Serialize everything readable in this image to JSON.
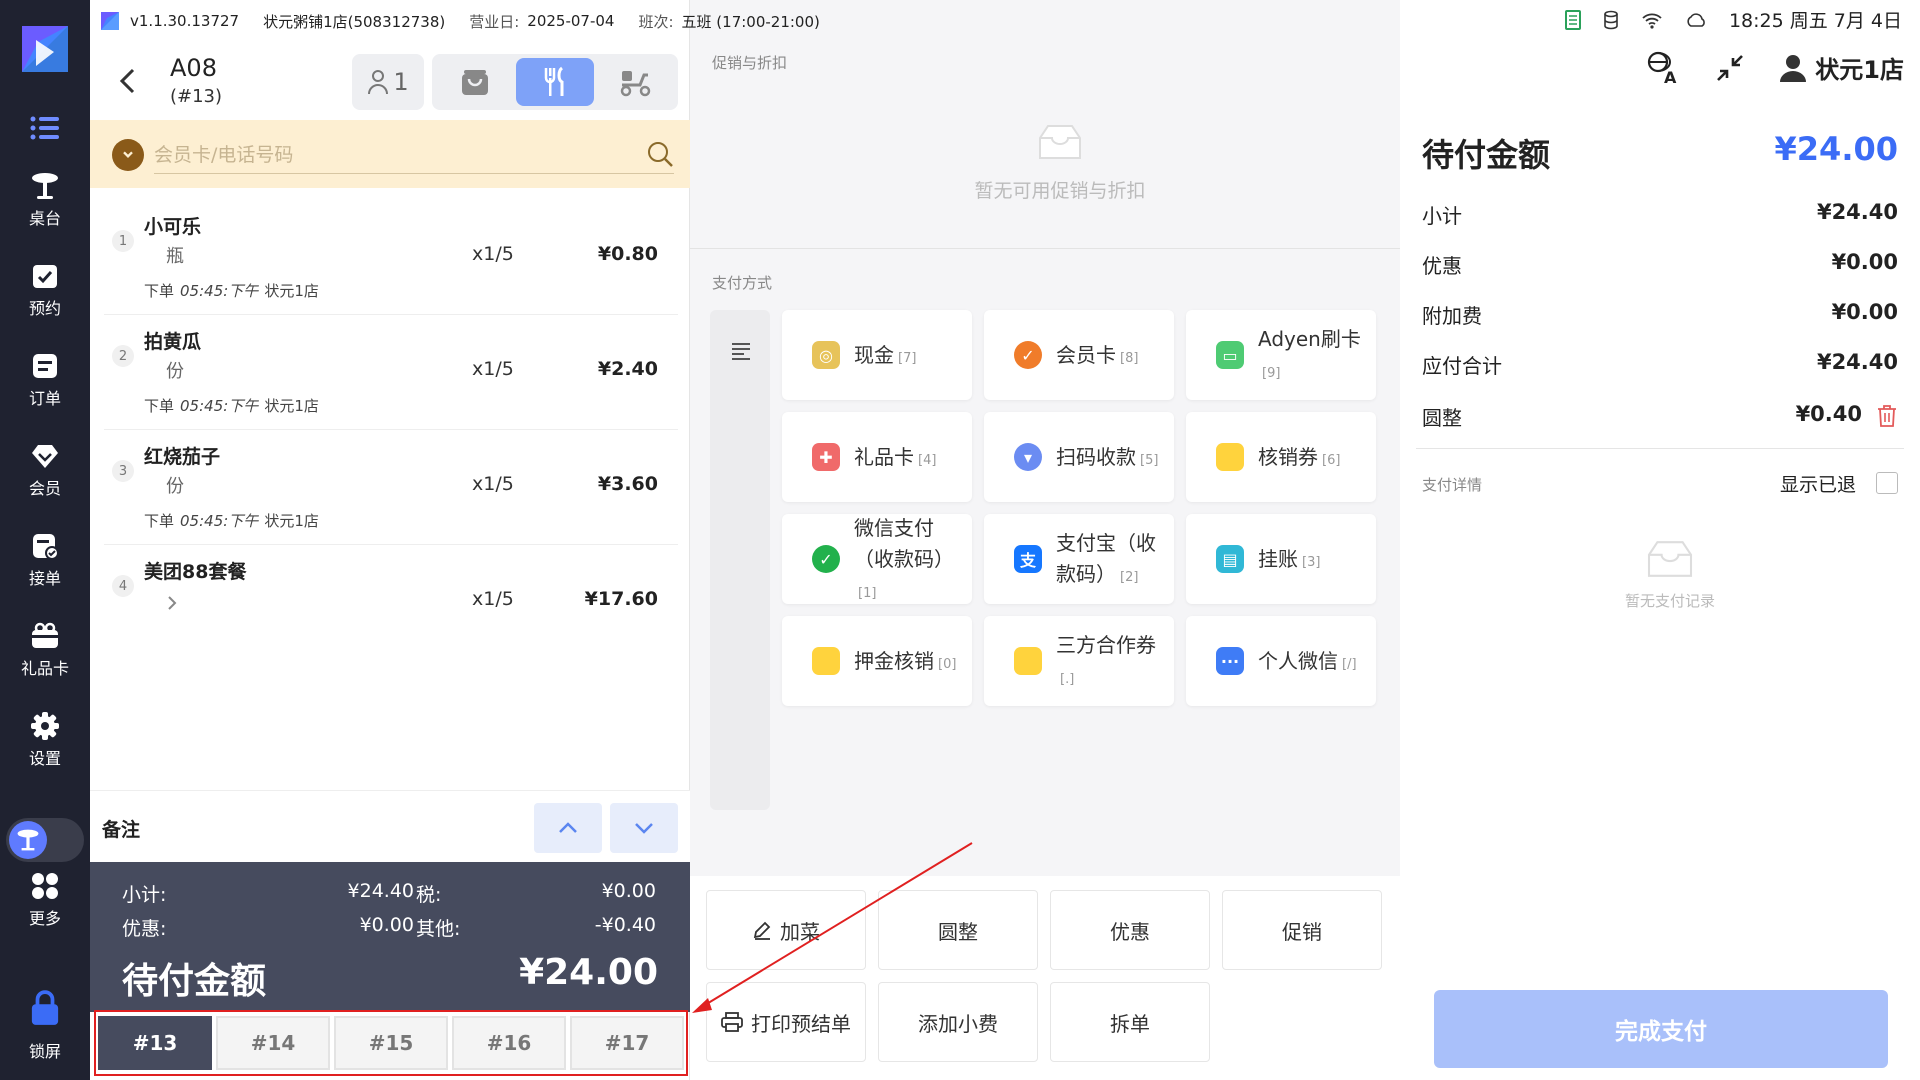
{
  "topbar": {
    "version": "v1.1.30.13727",
    "store": "状元粥铺1店(508312738)",
    "bizday_label": "营业日:",
    "bizday": "2025-07-04",
    "shift_label": "班次:",
    "shift": "五班 (17:00-21:00)"
  },
  "sidebar": {
    "items": [
      {
        "label": "",
        "icon": "list-icon"
      },
      {
        "label": "桌台",
        "icon": "table-icon"
      },
      {
        "label": "预约",
        "icon": "reservation-icon"
      },
      {
        "label": "订单",
        "icon": "order-icon"
      },
      {
        "label": "会员",
        "icon": "member-icon"
      },
      {
        "label": "接单",
        "icon": "accept-order-icon"
      },
      {
        "label": "礼品卡",
        "icon": "gift-card-icon"
      },
      {
        "label": "设置",
        "icon": "gear-icon"
      },
      {
        "label": "更多",
        "icon": "grid-icon"
      },
      {
        "label": "锁屏",
        "icon": "lock-icon"
      }
    ]
  },
  "order": {
    "table": "A08",
    "check_no": "(#13)",
    "guests": "1",
    "member_placeholder": "会员卡/电话号码",
    "items": [
      {
        "no": "1",
        "name": "小可乐",
        "unit": "瓶",
        "qty": "x1/5",
        "price": "¥0.80",
        "meta_a": "下单",
        "meta_time": "05:45:下午",
        "meta_store": "状元1店"
      },
      {
        "no": "2",
        "name": "拍黄瓜",
        "unit": "份",
        "qty": "x1/5",
        "price": "¥2.40",
        "meta_a": "下单",
        "meta_time": "05:45:下午",
        "meta_store": "状元1店"
      },
      {
        "no": "3",
        "name": "红烧茄子",
        "unit": "份",
        "qty": "x1/5",
        "price": "¥3.60",
        "meta_a": "下单",
        "meta_time": "05:45:下午",
        "meta_store": "状元1店"
      },
      {
        "no": "4",
        "name": "美团88套餐",
        "unit": "",
        "qty": "x1/5",
        "price": "¥17.60",
        "meta_a": "",
        "meta_time": "",
        "meta_store": ""
      }
    ],
    "remark_label": "备注",
    "summary": {
      "subtotal_label": "小计:",
      "subtotal": "¥24.40",
      "tax_label": "税:",
      "tax": "¥0.00",
      "discount_label": "优惠:",
      "discount": "¥0.00",
      "other_label": "其他:",
      "other": "-¥0.40",
      "due_label": "待付金额",
      "due": "¥24.00"
    },
    "checks": [
      "#13",
      "#14",
      "#15",
      "#16",
      "#17"
    ]
  },
  "middle": {
    "promo_title": "促销与折扣",
    "promo_empty": "暂无可用促销与折扣",
    "pay_title": "支付方式",
    "pay_methods": [
      {
        "label": "现金",
        "count": "[7]",
        "color": "#e7c35a"
      },
      {
        "label": "会员卡",
        "count": "[8]",
        "color": "#f07c2a"
      },
      {
        "label": "Adyen刷卡",
        "count": "[9]",
        "color": "#4ecb73"
      },
      {
        "label": "礼品卡",
        "count": "[4]",
        "color": "#f06a6a"
      },
      {
        "label": "扫码收款",
        "count": "[5]",
        "color": "#6b8cf2"
      },
      {
        "label": "核销券",
        "count": "[6]",
        "color": "#ffd33d"
      },
      {
        "label": "微信支付（收款码）",
        "count": "[1]",
        "color": "#22b14c"
      },
      {
        "label": "支付宝（收款码）",
        "count": "[2]",
        "color": "#1677ff"
      },
      {
        "label": "挂账",
        "count": "[3]",
        "color": "#30b8d6"
      },
      {
        "label": "押金核销",
        "count": "[0]",
        "color": "#ffd33d"
      },
      {
        "label": "三方合作券",
        "count": "[.]",
        "color": "#ffd33d"
      },
      {
        "label": "个人微信",
        "count": "[/]",
        "color": "#3f7cf6"
      }
    ],
    "actions": [
      {
        "label": "加菜",
        "icon": "pen-icon"
      },
      {
        "label": "圆整",
        "icon": ""
      },
      {
        "label": "优惠",
        "icon": ""
      },
      {
        "label": "促销",
        "icon": ""
      },
      {
        "label": "打印预结单",
        "icon": "printer-icon"
      },
      {
        "label": "添加小费",
        "icon": ""
      },
      {
        "label": "拆单",
        "icon": ""
      }
    ]
  },
  "right": {
    "clock": "18:25 周五 7月 4日",
    "user": "状元1店",
    "due_label": "待付金额",
    "due": "¥24.00",
    "rows": [
      {
        "label": "小计",
        "value": "¥24.40"
      },
      {
        "label": "优惠",
        "value": "¥0.00"
      },
      {
        "label": "附加费",
        "value": "¥0.00"
      },
      {
        "label": "应付合计",
        "value": "¥24.40"
      },
      {
        "label": "圆整",
        "value": "¥0.40"
      }
    ],
    "pay_detail_title": "支付详情",
    "show_refunded": "显示已退",
    "no_records": "暂无支付记录",
    "finish": "完成支付"
  },
  "colors": {
    "accent": "#3b6cf6",
    "dark_panel": "#464b5e",
    "sidebar": "#1f2230",
    "annotation": "#e02020"
  }
}
